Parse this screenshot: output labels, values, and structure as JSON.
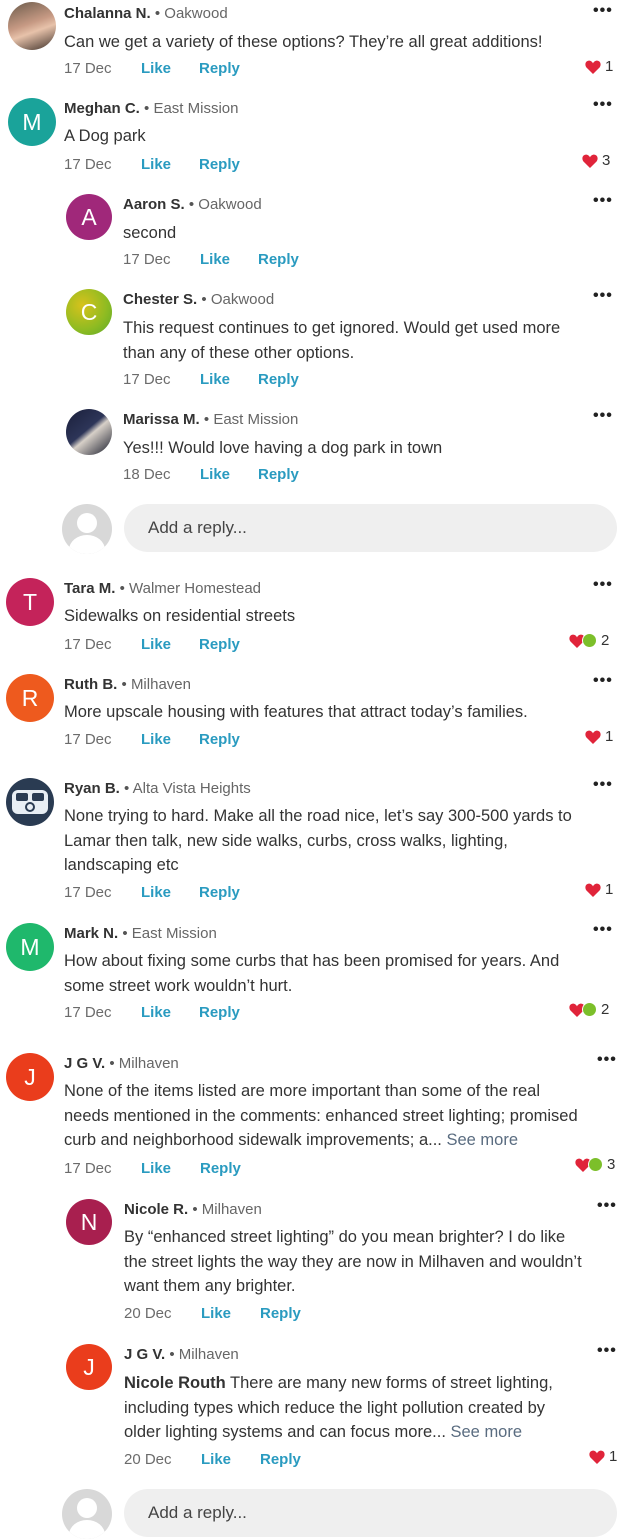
{
  "comments": [
    {
      "avatar_initial": "",
      "name": "Chalanna N.",
      "hood": "Oakwood",
      "lines": [
        "Can we get a variety of these options? They’re all great additions!"
      ],
      "date": "17 Dec",
      "like": "Like",
      "reply": "Reply",
      "reactions": "1"
    },
    {
      "avatar_initial": "M",
      "avatar_color": "#1aa39a",
      "name": "Meghan C.",
      "hood": "East Mission",
      "lines": [
        "A Dog park"
      ],
      "date": "17 Dec",
      "like": "Like",
      "reply": "Reply",
      "reactions": "3",
      "replies": [
        {
          "avatar_initial": "A",
          "avatar_color": "#a0287a",
          "name": "Aaron S.",
          "hood": "Oakwood",
          "lines": [
            "second"
          ],
          "date": "17 Dec",
          "like": "Like",
          "reply": "Reply"
        },
        {
          "avatar_initial": "C",
          "avatar_color": "#a9b81e",
          "name": "Chester S.",
          "hood": "Oakwood",
          "lines": [
            "This request continues to get ignored.  Would get used more",
            "than any of these other options."
          ],
          "date": "17 Dec",
          "like": "Like",
          "reply": "Reply"
        },
        {
          "avatar_initial": "",
          "name": "Marissa M.",
          "hood": "East Mission",
          "lines": [
            "Yes!!! Would love having a dog park in town"
          ],
          "date": "18 Dec",
          "like": "Like",
          "reply": "Reply"
        }
      ]
    },
    {
      "avatar_initial": "T",
      "avatar_color": "#c4235a",
      "name": "Tara M.",
      "hood": "Walmer Homestead",
      "lines": [
        "Sidewalks on residential streets"
      ],
      "date": "17 Dec",
      "like": "Like",
      "reply": "Reply",
      "reactions": "2"
    },
    {
      "avatar_initial": "R",
      "avatar_color": "#ee5a1e",
      "name": "Ruth B.",
      "hood": "Milhaven",
      "lines": [
        "More upscale housing with features that attract today’s families."
      ],
      "date": "17 Dec",
      "like": "Like",
      "reply": "Reply",
      "reactions": "1"
    },
    {
      "avatar_initial": "",
      "name": "Ryan B.",
      "hood": "Alta Vista Heights",
      "lines": [
        "None trying to hard.  Make all the road nice,  let’s say 300-500 yards to",
        "Lamar then talk, new side walks, curbs, cross walks, lighting,",
        "landscaping etc"
      ],
      "date": "17 Dec",
      "like": "Like",
      "reply": "Reply",
      "reactions": "1"
    },
    {
      "avatar_initial": "M",
      "avatar_color": "#1fb86c",
      "name": "Mark N.",
      "hood": "East Mission",
      "lines": [
        "How about fixing some curbs that has been promised for years. And",
        "some street work wouldn’t hurt."
      ],
      "date": "17 Dec",
      "like": "Like",
      "reply": "Reply",
      "reactions": "2"
    },
    {
      "avatar_initial": "J",
      "avatar_color": "#ea3d1c",
      "name": "J G V.",
      "hood": "Milhaven",
      "lines": [
        "None of the items listed are more important than some of the real",
        "needs mentioned in the comments: enhanced street lighting; promised",
        "curb and neighborhood sidewalk improvements; a..."
      ],
      "see_more": "See more",
      "date": "17 Dec",
      "like": "Like",
      "reply": "Reply",
      "reactions": "3",
      "replies": [
        {
          "avatar_initial": "N",
          "avatar_color": "#a81f4f",
          "name": "Nicole R.",
          "hood": "Milhaven",
          "lines": [
            "By “enhanced street lighting” do you mean brighter? I do like",
            "the street lights the way they are now in Milhaven and wouldn’t",
            "want them any brighter."
          ],
          "date": "20 Dec",
          "like": "Like",
          "reply": "Reply"
        },
        {
          "avatar_initial": "J",
          "avatar_color": "#ea3d1c",
          "name": "J G V.",
          "hood": "Milhaven",
          "tag": "Nicole Routh",
          "lines": [
            "There are many new forms of street lighting,",
            "including types which reduce the light pollution created by",
            "older lighting systems and can focus more..."
          ],
          "see_more": "See more",
          "date": "20 Dec",
          "like": "Like",
          "reply": "Reply",
          "reactions": "1"
        }
      ]
    }
  ],
  "add_reply_placeholder": "Add a reply...",
  "dot_separator": "•",
  "more_icon": "•••",
  "colors": {
    "accent": "#2a9bc0",
    "heart": "#e0243a",
    "thumb": "#7cbf2a"
  }
}
